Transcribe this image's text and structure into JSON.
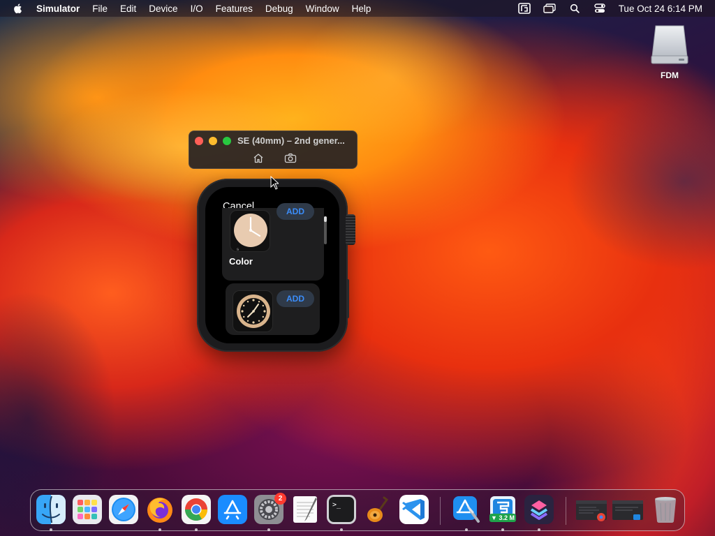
{
  "menubar": {
    "app_name": "Simulator",
    "items": [
      "File",
      "Edit",
      "Device",
      "I/O",
      "Features",
      "Debug",
      "Window",
      "Help"
    ],
    "clock": "Tue Oct 24  6:14 PM",
    "status_icons": [
      "fdm-icon",
      "screen-mirroring-icon",
      "search-icon",
      "control-center-icon"
    ]
  },
  "desktop": {
    "drive_label": "FDM"
  },
  "simulator": {
    "window_title": "SE (40mm) – 2nd gener...",
    "tools": [
      "home-icon",
      "screenshot-icon"
    ]
  },
  "watch": {
    "cancel_label": "Cancel",
    "cards": [
      {
        "add_label": "ADD",
        "face_name": "Color",
        "face_style": "cream-analog"
      },
      {
        "add_label": "ADD",
        "face_style": "gold-analog"
      }
    ]
  },
  "dock": {
    "apps": [
      {
        "name": "Finder",
        "icon": "finder-icon"
      },
      {
        "name": "Launchpad",
        "icon": "launchpad-icon"
      },
      {
        "name": "Safari",
        "icon": "safari-icon"
      },
      {
        "name": "Firefox",
        "icon": "firefox-icon"
      },
      {
        "name": "Google Chrome",
        "icon": "chrome-icon"
      },
      {
        "name": "App Store",
        "icon": "app-store-icon"
      },
      {
        "name": "System Settings",
        "icon": "settings-icon",
        "badge": "2"
      },
      {
        "name": "TextEdit",
        "icon": "textedit-icon"
      },
      {
        "name": "Terminal",
        "icon": "terminal-icon"
      },
      {
        "name": "GarageBand",
        "icon": "garageband-icon"
      },
      {
        "name": "Visual Studio Code",
        "icon": "vscode-icon"
      },
      {
        "name": "Xcode",
        "icon": "xcode-icon"
      },
      {
        "name": "Free Download Manager",
        "icon": "fdm-icon",
        "label": "▼ 3.2 M"
      },
      {
        "name": "Shortcuts",
        "icon": "shortcuts-icon"
      },
      {
        "name": "Chrome Window",
        "icon": "chrome-window-icon"
      },
      {
        "name": "Desktop Window",
        "icon": "desktop-window-icon"
      },
      {
        "name": "Trash",
        "icon": "trash-icon"
      }
    ]
  },
  "colors": {
    "accent_blue": "#3b8dfa",
    "badge_red": "#ff3b30",
    "traffic_red": "#ff5f57",
    "traffic_yellow": "#febc2e",
    "traffic_green": "#28c840"
  }
}
